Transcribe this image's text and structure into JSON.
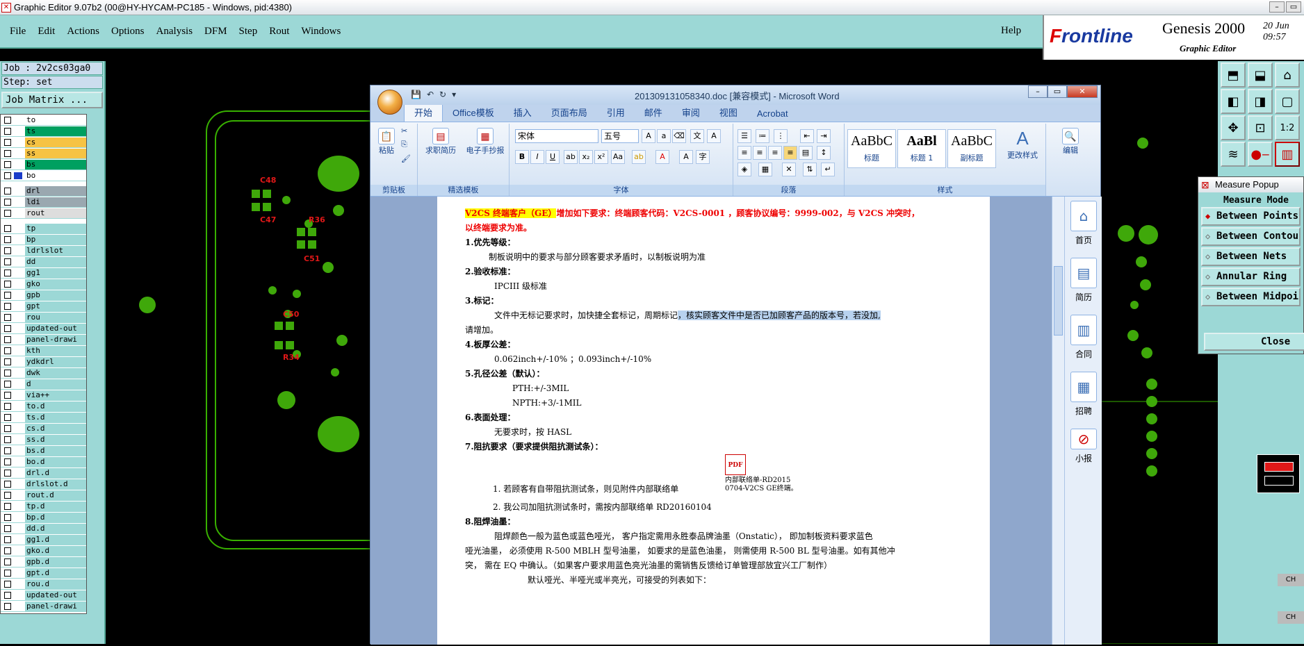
{
  "window": {
    "title": "Graphic Editor 9.07b2 (00@HY-HYCAM-PC185 - Windows, pid:4380)"
  },
  "menu": {
    "items": [
      "File",
      "Edit",
      "Actions",
      "Options",
      "Analysis",
      "DFM",
      "Step",
      "Rout",
      "Windows"
    ],
    "help": "Help"
  },
  "brand": {
    "logo": "Frontline",
    "product": "Genesis 2000",
    "sub": "Graphic Editor",
    "date": "20 Jun",
    "time": "09:57"
  },
  "job": {
    "job_line": "Job : 2v2cs03ga0",
    "step_line": "Step: set",
    "matrix_button": "Job Matrix ..."
  },
  "layers": [
    {
      "name": "to",
      "color": "#ffffff"
    },
    {
      "name": "ts",
      "color": "#00a060"
    },
    {
      "name": "cs",
      "color": "#f6c343"
    },
    {
      "name": "ss",
      "color": "#f6c343"
    },
    {
      "name": "bs",
      "color": "#00a060"
    },
    {
      "name": "bo",
      "color": "#ffffff"
    },
    {
      "name": "drl",
      "color": "#9aa8b0"
    },
    {
      "name": "ldi",
      "color": "#9aa8b0"
    },
    {
      "name": "rout",
      "color": "#dddddd"
    },
    {
      "name": "tp"
    },
    {
      "name": "bp"
    },
    {
      "name": "ldrlslot"
    },
    {
      "name": "dd"
    },
    {
      "name": "gg1"
    },
    {
      "name": "gko"
    },
    {
      "name": "gpb"
    },
    {
      "name": "gpt"
    },
    {
      "name": "rou"
    },
    {
      "name": "updated-out"
    },
    {
      "name": "panel-drawi"
    },
    {
      "name": "kth"
    },
    {
      "name": "ydkdrl"
    },
    {
      "name": "dwk"
    },
    {
      "name": "d"
    },
    {
      "name": "via++"
    },
    {
      "name": "to.d"
    },
    {
      "name": "ts.d"
    },
    {
      "name": "cs.d"
    },
    {
      "name": "ss.d"
    },
    {
      "name": "bs.d"
    },
    {
      "name": "bo.d"
    },
    {
      "name": "drl.d"
    },
    {
      "name": "drlslot.d"
    },
    {
      "name": "rout.d"
    },
    {
      "name": "tp.d"
    },
    {
      "name": "bp.d"
    },
    {
      "name": "dd.d"
    },
    {
      "name": "gg1.d"
    },
    {
      "name": "gko.d"
    },
    {
      "name": "gpb.d"
    },
    {
      "name": "gpt.d"
    },
    {
      "name": "rou.d"
    },
    {
      "name": "updated-out"
    },
    {
      "name": "panel-drawi"
    }
  ],
  "canvas": {
    "silk_labels": [
      "C48",
      "C47",
      "R36",
      "C51",
      "C50",
      "R34"
    ]
  },
  "measure": {
    "title": "Measure Popup",
    "mode_label": "Measure Mode",
    "options": [
      "Between Points",
      "Between Contours",
      "Between Nets",
      "Annular Ring",
      "Between Midpoints"
    ],
    "close": "Close"
  },
  "word": {
    "title": "20130913105834​0.doc [兼容模式] - Microsoft Word",
    "tabs": [
      "开始",
      "Office模板",
      "插入",
      "页面布局",
      "引用",
      "邮件",
      "审阅",
      "视图",
      "Acrobat"
    ],
    "groups": [
      "剪贴板",
      "精选模板",
      "字体",
      "段落",
      "样式"
    ],
    "paste": "粘贴",
    "templates": [
      "求职简历",
      "电子手抄报"
    ],
    "font_name": "宋体",
    "font_size": "五号",
    "styles": [
      {
        "preview": "AaBbC",
        "name": "标题"
      },
      {
        "preview": "AaBl",
        "name": "标题 1"
      },
      {
        "preview": "AaBbC",
        "name": "副标题"
      }
    ],
    "change_styles": "更改样式",
    "edit": "编辑",
    "side_items": [
      "首页",
      "简历",
      "合同",
      "招聘",
      "小报"
    ]
  },
  "document": {
    "p1a": "V2CS 终端客户（GE）",
    "p1b": "增加如下要求：终端顾客代码：V2CS-0001 ，顾客协议编号：9999-002，与 V2CS 冲突时，",
    "p1c": "以终端要求为准。",
    "h1": "1.优先等级：",
    "t1": "制板说明中的要求与部分顾客要求矛盾时，以制板说明为准",
    "h2": "2.验收标准：",
    "t2": "IPCIII 级标准",
    "h3": "3.标记：",
    "t3a": "文件中无标记要求时，加快捷全套标记，周期标记",
    "t3b": "，核实顾客文件中是否已加顾客产品的版本号，若没加,",
    "t3c": "请增加。",
    "h4": "4.板厚公差：",
    "t4": "0.062inch+/-10% ；0.093inch+/-10%",
    "h5": "5.孔径公差（默认）：",
    "t5a": "PTH:+/-3MIL",
    "t5b": "NPTH:+3/-1MIL",
    "h6": "6.表面处理：",
    "t6": "无要求时，按 HASL",
    "h7": "7.阻抗要求（要求提供阻抗测试条）：",
    "attach1": "内部联络单-RD2015",
    "attach2": "0704-V2CS GE终端。",
    "l1": "1. 若顾客有自带阻抗测试条，则见附件内部联络单",
    "l2": "2. 我公司加阻抗测试条时，需按内部联络单 RD20160104",
    "h8": "8.阻焊油墨：",
    "t8a": "阻焊颜色一般为蓝色或蓝色哑光， 客户指定需用永胜泰品牌油墨（Onstatic）， 即加制板资料要求蓝色",
    "t8b": "哑光油墨， 必须使用 R-500 MBLH 型号油墨， 如要求的是蓝色油墨， 则需使用 R-500 BL 型号油墨。如有其他冲",
    "t8c": "突， 需在 EQ 中确认。（如果客户要求用蓝色亮光油墨的需销售反馈给订单管理部放宜兴工厂制作）",
    "t8d": "默认哑光、半哑光或半亮光，可接受的列表如下："
  },
  "colors": {
    "panel": "#9cd8d6",
    "pad": "#3fa80a",
    "outline": "#38b000",
    "silk": "#e01818"
  }
}
